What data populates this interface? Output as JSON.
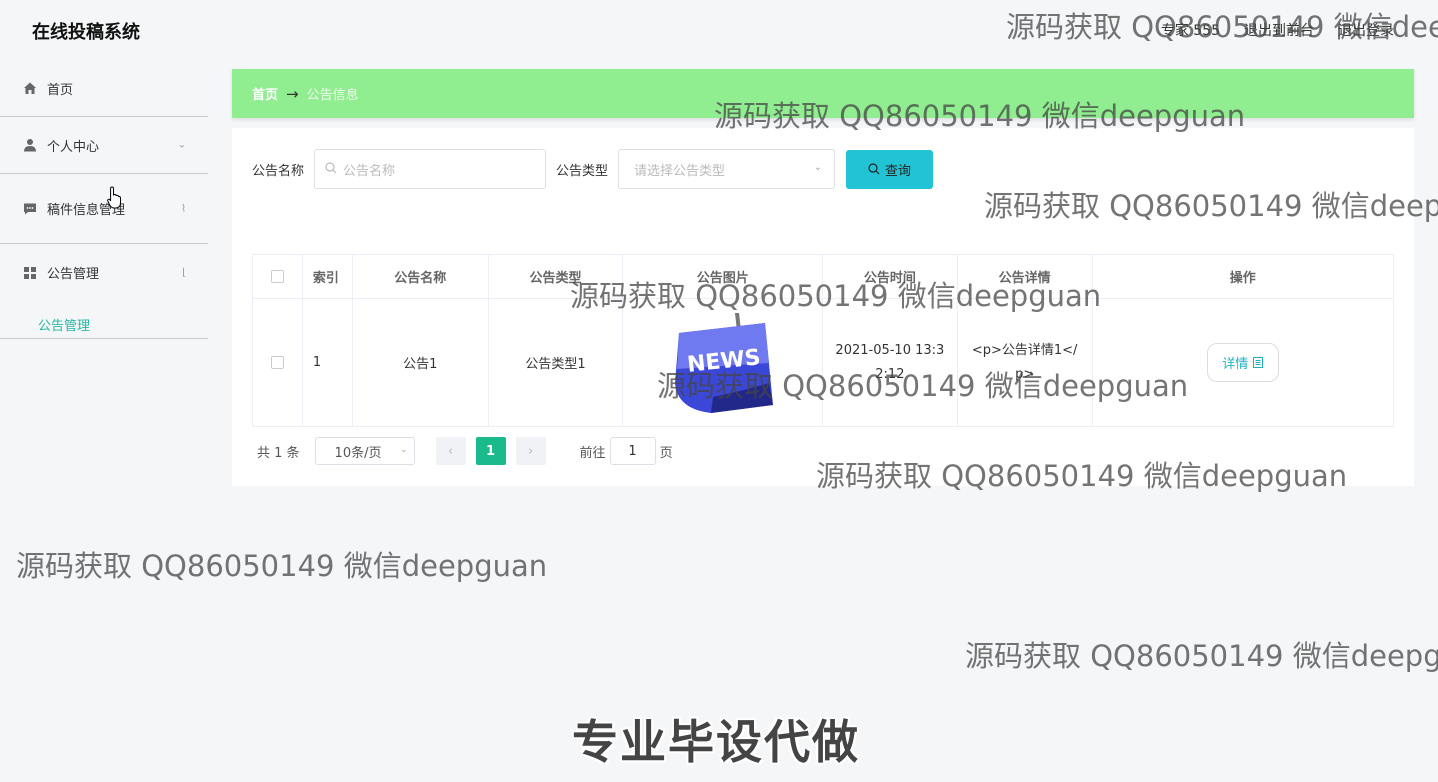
{
  "header": {
    "title": "在线投稿系统",
    "user": "专家 555",
    "back_to_front": "退出到前台",
    "logout": "退出登录"
  },
  "sidebar": {
    "items": [
      {
        "label": "首页",
        "icon": "home-icon"
      },
      {
        "label": "个人中心",
        "icon": "user-icon"
      },
      {
        "label": "稿件信息管理",
        "icon": "message-icon"
      },
      {
        "label": "公告管理",
        "icon": "grid-icon"
      }
    ],
    "submenu": {
      "label": "公告管理"
    }
  },
  "breadcrumb": {
    "home": "首页",
    "arrow": "→",
    "current": "公告信息"
  },
  "search": {
    "name_label": "公告名称",
    "name_placeholder": "公告名称",
    "type_label": "公告类型",
    "type_placeholder": "请选择公告类型",
    "query_button": "查询"
  },
  "table": {
    "columns": [
      "",
      "索引",
      "公告名称",
      "公告类型",
      "公告图片",
      "公告时间",
      "公告详情",
      "操作"
    ],
    "rows": [
      {
        "index": "1",
        "name": "公告1",
        "type": "公告类型1",
        "image_label": "NEWS",
        "time": "2021-05-10 13:32:12",
        "detail": "<p>公告详情1</p>",
        "action": "详情"
      }
    ]
  },
  "pagination": {
    "total": "共 1 条",
    "page_size": "10条/页",
    "current_page": "1",
    "goto_label": "前往",
    "goto_value": "1",
    "page_suffix": "页"
  },
  "watermark": {
    "text": "源码获取 QQ86050149 微信deepguan",
    "banner": "专业毕设代做"
  },
  "colors": {
    "breadcrumb_bg": "#90ee90",
    "query_button": "#22c3d5",
    "active_page": "#1aba8c",
    "submenu_active": "#26b6a6"
  }
}
